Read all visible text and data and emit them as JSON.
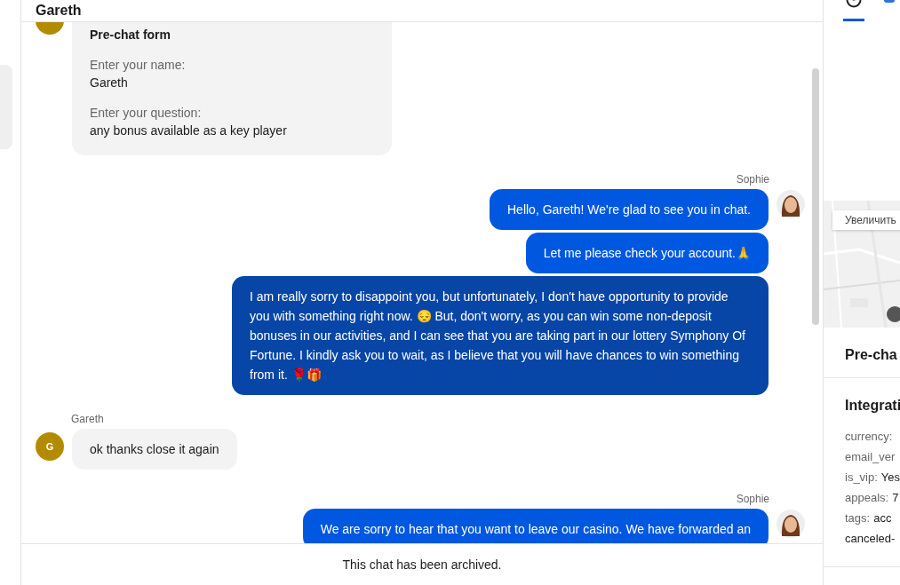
{
  "header": {
    "title": "Gareth"
  },
  "conversation": [
    {
      "kind": "customer",
      "messages": [
        {
          "kind": "form",
          "title": "Pre-chat form",
          "fields": [
            {
              "label": "Enter your name:",
              "value": "Gareth"
            },
            {
              "label": "Enter your question:",
              "value": "any bonus available as a key player"
            }
          ]
        }
      ]
    },
    {
      "sender": "Sophie",
      "kind": "agent",
      "messages": [
        {
          "kind": "text",
          "color": "#0058e0",
          "text": "Hello, Gareth! We're glad to see you in chat."
        },
        {
          "kind": "text",
          "color": "#0058e0",
          "text": "Let me please check your account.🙏"
        },
        {
          "kind": "text",
          "color": "#0746a6",
          "text": "I am really sorry to disappoint you, but unfortunately, I don't have opportunity to provide you with something right now. 😔 But, don't worry, as you can win some non-deposit bonuses in our activities, and I can see that you are taking part in our lottery Symphony Of Fortune. I kindly ask you to wait, as I believe that you will have chances to win something from it. 🌹🎁"
        }
      ]
    },
    {
      "sender": "Gareth",
      "kind": "customer",
      "avatar": "G",
      "messages": [
        {
          "kind": "text",
          "color": "#f3f3f3",
          "text": "ok thanks close it again"
        }
      ]
    },
    {
      "sender": "Sophie",
      "kind": "agent",
      "messages": [
        {
          "kind": "text",
          "color": "#0058e0",
          "text": "We are sorry to hear that you want to leave our casino. We have forwarded an"
        }
      ]
    }
  ],
  "footer": {
    "notice": "This chat has been archived."
  },
  "sidebar": {
    "tabs": [
      {
        "kind": "person",
        "selected": true
      },
      {
        "kind": "chat",
        "selected": false
      }
    ],
    "map": {
      "kind": "picture",
      "button": "Увеличить"
    },
    "sections": [
      {
        "title": "Pre-cha"
      },
      {
        "title": "Integrati",
        "rows": [
          {
            "key": "currency:"
          },
          {
            "key": "email_ver"
          },
          {
            "key": "is_vip:",
            "value": "Yes"
          },
          {
            "key": "appeals:",
            "value": "7"
          },
          {
            "key": "tags:",
            "value": "acc"
          },
          {
            "value": "canceled-"
          }
        ]
      }
    ]
  }
}
